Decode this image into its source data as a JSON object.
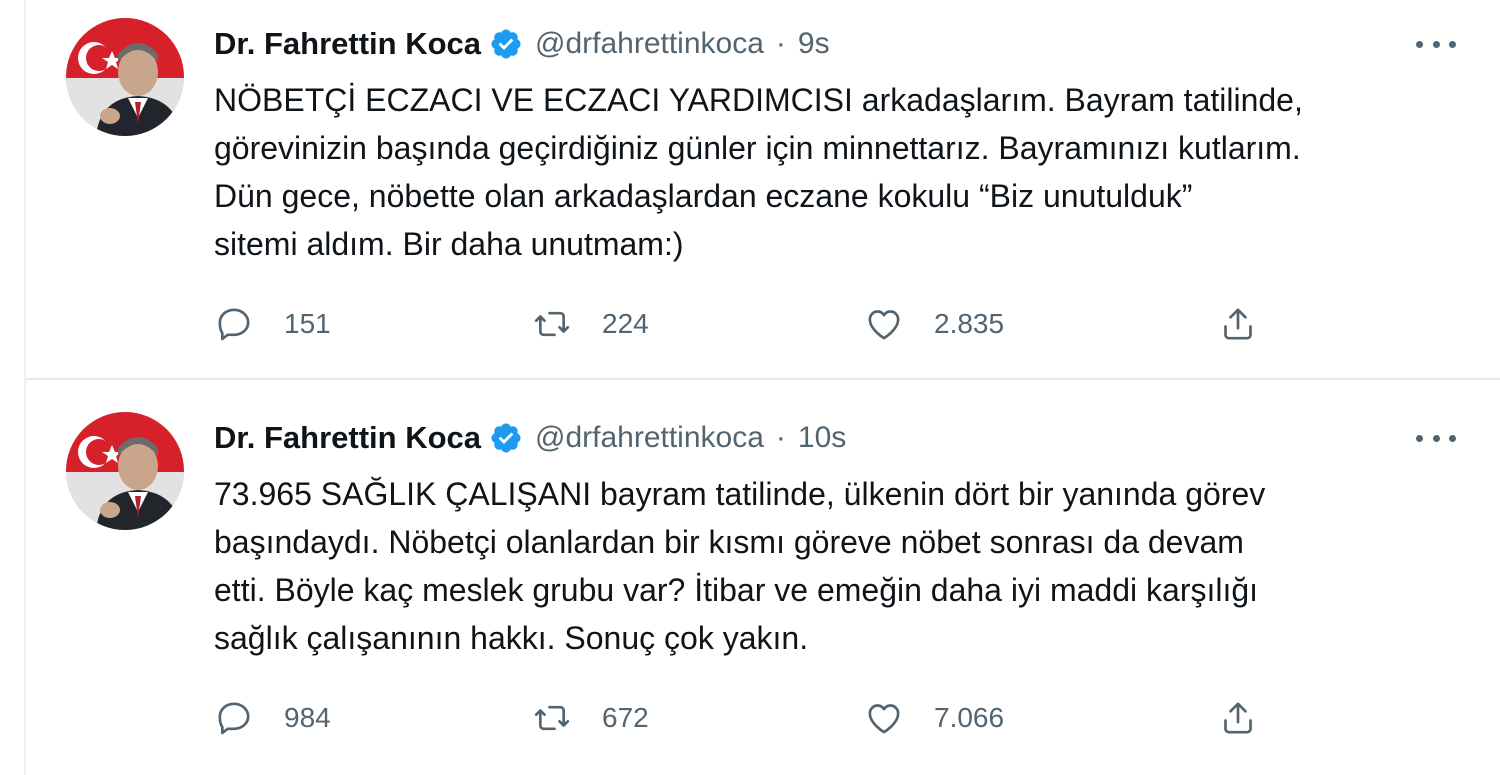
{
  "tweets": [
    {
      "author": {
        "name": "Dr. Fahrettin Koca",
        "handle": "@drfahrettinkoca",
        "verified": true
      },
      "separator": "·",
      "time": "9s",
      "lines": [
        "NÖBETÇİ ECZACI VE ECZACI YARDIMCISI arkadaşlarım. Bayram tatilinde,",
        "görevinizin başında geçirdiğiniz günler için minnettarız. Bayramınızı kutlarım.",
        "Dün gece, nöbette olan arkadaşlardan eczane kokulu “Biz unutulduk”",
        "sitemi aldım. Bir daha unutmam:)"
      ],
      "stats": {
        "replies": "151",
        "retweets": "224",
        "likes": "2.835"
      }
    },
    {
      "author": {
        "name": "Dr. Fahrettin Koca",
        "handle": "@drfahrettinkoca",
        "verified": true
      },
      "separator": "·",
      "time": "10s",
      "lines": [
        "73.965 SAĞLIK ÇALIŞANI bayram tatilinde, ülkenin dört bir yanında görev",
        "başındaydı. Nöbetçi olanlardan bir kısmı göreve nöbet sonrası da devam",
        "etti. Böyle kaç meslek grubu var? İtibar ve emeğin daha iyi maddi karşılığı",
        "sağlık çalışanının hakkı. Sonuç çok yakın."
      ],
      "stats": {
        "replies": "984",
        "retweets": "672",
        "likes": "7.066"
      }
    }
  ],
  "icons": {
    "verified": "verified-badge-icon",
    "more": "more-dots-icon",
    "reply": "reply-bubble-icon",
    "retweet": "retweet-arrows-icon",
    "like": "heart-icon",
    "share": "share-upload-icon"
  },
  "colors": {
    "text_primary": "#0f1419",
    "text_secondary": "#536471",
    "verified_blue": "#1d9bf0",
    "divider": "#e6eaed"
  }
}
